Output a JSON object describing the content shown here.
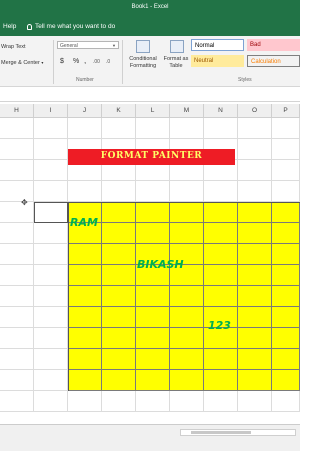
{
  "window": {
    "title": "Book1  -  Excel"
  },
  "menu": {
    "help": "Help",
    "tell_me": "Tell me what you want to do"
  },
  "ribbon": {
    "wrap_text": "Wrap Text",
    "merge_center": "Merge & Center",
    "number_format": "General",
    "currency": "$",
    "percent": "%",
    "comma": ",",
    "number_group": "Number",
    "conditional_formatting": "Conditional Formatting",
    "format_as_table": "Format as Table",
    "styles": {
      "normal": "Normal",
      "bad": "Bad",
      "neutral": "Neutral",
      "calculation": "Calculation"
    },
    "styles_group": "Styles"
  },
  "columns": [
    "H",
    "I",
    "J",
    "K",
    "L",
    "M",
    "N",
    "O",
    "P"
  ],
  "sheet": {
    "banner": "FORMAT PAINTER",
    "ram": "RAM",
    "bikash": "BIKASH",
    "number": "123"
  },
  "colors": {
    "excel_green": "#217346",
    "banner_red": "#ee1c25",
    "banner_text": "#ffff66",
    "fill_yellow": "#ffff00",
    "text_green": "#00b050"
  }
}
